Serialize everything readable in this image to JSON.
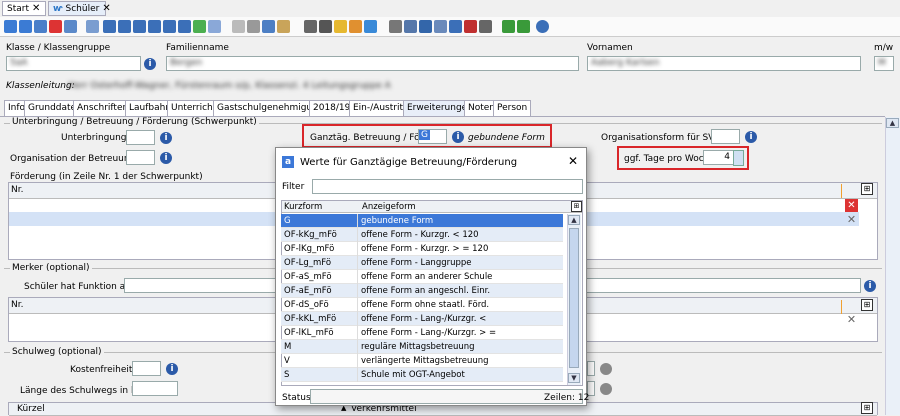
{
  "tabs": [
    {
      "label": "Start"
    },
    {
      "label": "Schüler"
    }
  ],
  "colors": {
    "accent": "#3c78d8",
    "highlight_box": "#d9262a",
    "info_icon": "#2b5aa8"
  },
  "header": {
    "klasse_label": "Klasse / Klassengruppe",
    "klasse_value": "5aA",
    "familienname_label": "Familienname",
    "familienname_value": "Bergen",
    "vornamen_label": "Vornamen",
    "vornamen_value": "Aaberg Karlsen",
    "mw_label": "m/w",
    "mw_value": "M",
    "klassenleitung_label": "Klassenleitung:",
    "klassenleitung_value": "Herr Osterhoff-Wagner, Fürstenraum o/p, Klassenzi. 4 Leitungsgruppe A"
  },
  "subtabs": [
    "Info",
    "Grunddaten",
    "Anschriften",
    "Laufbahn",
    "Unterricht",
    "Gastschulgenehmigung",
    "2018/19",
    "Ein-/Austritt",
    "Erweiterungen",
    "Noten",
    "Person"
  ],
  "section1": {
    "title": "Unterbringung / Betreuung / Förderung (Schwerpunkt)",
    "unterbringung_label": "Unterbringung",
    "organisation_label": "Organisation der Betreuung",
    "ganztag_label": "Ganztäg. Betreuung / Förd.",
    "ganztag_value": "G",
    "ganztag_desc": "gebundene Form",
    "orgform_label": "Organisationsform für SVE",
    "tage_label": "ggf. Tage pro Woche",
    "tage_value": "4",
    "foerderung_label": "Förderung (in Zeile Nr. 1 der  Schwerpunkt)",
    "grid_header": "Nr."
  },
  "section2": {
    "title": "Merker (optional)",
    "funktion_label": "Schüler hat Funktion als",
    "grid_header": "Nr."
  },
  "section3": {
    "title": "Schulweg (optional)",
    "kosten_label": "Kostenfreiheit",
    "laenge_label": "Länge des Schulwegs in km",
    "grid_col1": "Kürzel",
    "grid_col2": "Verkehrsmittel"
  },
  "dialog": {
    "title": "Werte für Ganztägige Betreuung/Förderung",
    "filter_label": "Filter",
    "col_kurz": "Kurzform",
    "col_anzeige": "Anzeigeform",
    "rows": [
      {
        "k": "G",
        "a": "gebundene Form"
      },
      {
        "k": "OF-kKg_mFö",
        "a": "offene Form - Kurzgr. < 120"
      },
      {
        "k": "OF-lKg_mFö",
        "a": "offene Form - Kurzgr. > = 120"
      },
      {
        "k": "OF-Lg_mFö",
        "a": "offene Form - Langgruppe"
      },
      {
        "k": "OF-aS_mFö",
        "a": "offene Form an anderer Schule"
      },
      {
        "k": "OF-aE_mFö",
        "a": "offene Form an angeschl. Einr."
      },
      {
        "k": "OF-dS_oFö",
        "a": "offene Form ohne staatl. Förd."
      },
      {
        "k": "OF-kKL_mFö",
        "a": "offene Form - Lang-/Kurzgr. <"
      },
      {
        "k": "OF-lKL_mFö",
        "a": "offene Form - Lang-/Kurzgr. > ="
      },
      {
        "k": "M",
        "a": "reguläre Mittagsbetreuung"
      },
      {
        "k": "V",
        "a": "verlängerte Mittagsbetreuung"
      },
      {
        "k": "S",
        "a": "Schule mit OGT-Angebot"
      }
    ],
    "status_label": "Status",
    "count_label": "Zeilen: 12"
  }
}
